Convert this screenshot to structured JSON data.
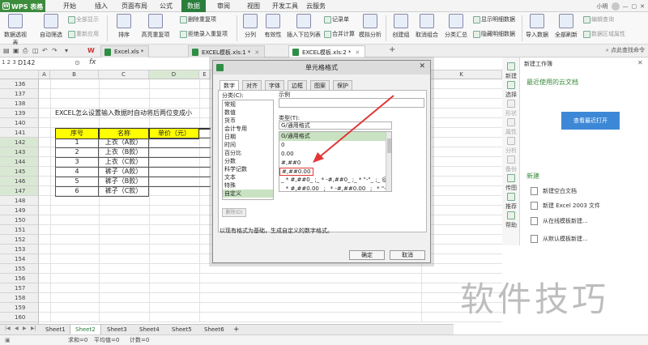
{
  "app": {
    "name": "WPS 表格"
  },
  "menu_tabs": [
    "开始",
    "插入",
    "页面布局",
    "公式",
    "数据",
    "审阅",
    "视图",
    "开发工具",
    "云服务"
  ],
  "active_menu_tab": "数据",
  "user": {
    "name": "小明",
    "search_hint": "点此查找命令"
  },
  "ribbon": {
    "big": [
      "数据透视表",
      "自动筛选",
      "排序",
      "高亮重复项",
      "拒绝录入重复项",
      "分列",
      "有效性",
      "插入下拉列表",
      "合并计算",
      "模拟分析",
      "创建组",
      "取消组合",
      "分类汇总",
      "导入数据",
      "全部刷新"
    ],
    "small": [
      "全部显示",
      "重新应用",
      "删除重复项",
      "记录单",
      "显示明细数据",
      "隐藏明细数据",
      "编辑查询",
      "数据区域属性"
    ]
  },
  "doc_tabs": [
    "Excel.xls *",
    "EXCEL模板.xls:1 *",
    "EXCEL模板.xls:2 *"
  ],
  "formula_bar": {
    "cell_ref": "D142",
    "fx": "fx"
  },
  "columns": [
    "A",
    "B",
    "C",
    "D",
    "E",
    "K"
  ],
  "rows": [
    "136",
    "137",
    "138",
    "139",
    "140",
    "141",
    "142",
    "143",
    "144",
    "145",
    "146",
    "147",
    "148",
    "149",
    "150",
    "151",
    "152",
    "153",
    "154",
    "155",
    "156",
    "157",
    "158",
    "159",
    "160",
    "161",
    "162"
  ],
  "sheet_title_text": "EXCEL怎么设置输入数据时自动将后两位变成小",
  "table": {
    "headers": [
      "序号",
      "名称",
      "单价（元）"
    ],
    "rows": [
      [
        "1",
        "上衣（A款）"
      ],
      [
        "2",
        "上衣（B款）"
      ],
      [
        "3",
        "上衣（C款）"
      ],
      [
        "4",
        "裤子（A款）"
      ],
      [
        "5",
        "裤子（B款）"
      ],
      [
        "6",
        "裤子（C款）"
      ]
    ]
  },
  "dialog": {
    "title": "单元格格式",
    "close": "✕",
    "tabs": [
      "数字",
      "对齐",
      "字体",
      "边框",
      "图案",
      "保护"
    ],
    "active_tab": "数字",
    "category_label": "分类(C):",
    "categories": [
      "常规",
      "数值",
      "货币",
      "会计专用",
      "日期",
      "时间",
      "百分比",
      "分数",
      "科学记数",
      "文本",
      "特殊",
      "自定义"
    ],
    "selected_category": "自定义",
    "sample_label": "示例",
    "type_label": "类型(T):",
    "type_value": "G/通用格式",
    "type_list": [
      "G/通用格式",
      "0",
      "0.00",
      "#,##0",
      "#,##0.00",
      "_ * #,##0_ ;_ * -#,##0_ ;_ * \"-\"_ ;_ @_",
      "_ * #,##0.00_ ;_ * -#,##0.00_ ;_ * \"-\"??_ ;_ @_"
    ],
    "highlighted_type": "#,##0.00",
    "delete_button": "删除(D)",
    "description": "以现有格式为基础，生成自定义的数字格式。",
    "ok": "确定",
    "cancel": "取消"
  },
  "task_pane": {
    "title": "新建工作簿",
    "recent_heading": "最近使用的云文档",
    "open_button": "查看最近打开",
    "new_heading": "新建",
    "new_items": [
      "新建空白文档",
      "新建 Excel 2003 文件",
      "从在线模板新建...",
      "从默认模板新建..."
    ],
    "side_items": [
      "新建",
      "选择",
      "形状",
      "属性",
      "分析",
      "备份",
      "传图",
      "推荐",
      "帮助"
    ]
  },
  "sheet_tabs": [
    "Sheet1",
    "Sheet2",
    "Sheet3",
    "Sheet4",
    "Sheet5",
    "Sheet6"
  ],
  "active_sheet": "Sheet2",
  "status": {
    "sum": "求和=0",
    "avg": "平均值=0",
    "count": "计数=0"
  },
  "watermark": "软件技巧",
  "colors": {
    "wps_green": "#2a7e3c",
    "header_yellow": "#ffff00",
    "selection_green": "#c9e3c2",
    "annotation_red": "#e23636",
    "link_blue": "#3d88d6"
  }
}
